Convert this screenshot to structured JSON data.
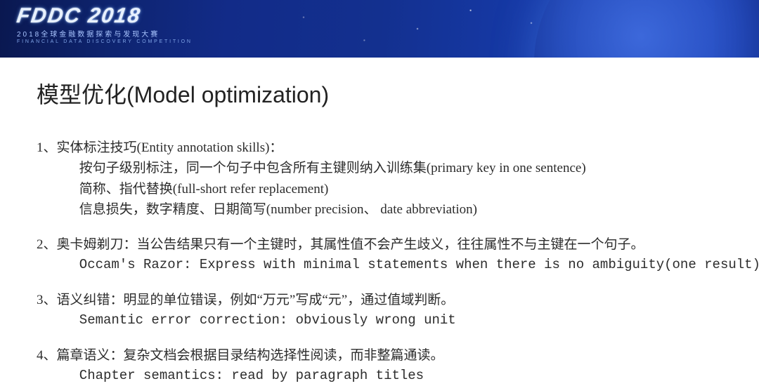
{
  "banner": {
    "logo_main": "FDDC 2018",
    "logo_sub_cn": "2018全球金融数据探索与发现大赛",
    "logo_sub_en": "FINANCIAL DATA DISCOVERY COMPETITION"
  },
  "slide": {
    "title": "模型优化(Model optimization)",
    "items": [
      {
        "head": "1、实体标注技巧(Entity annotation skills)：",
        "lines": [
          "按句子级别标注，同一个句子中包含所有主键则纳入训练集(primary key in one sentence)",
          "简称、指代替换(full-short refer replacement)",
          "信息损失，数字精度、日期简写(number precision、 date abbreviation)"
        ]
      },
      {
        "head": "2、奥卡姆剃刀：当公告结果只有一个主键时，其属性值不会产生歧义，往往属性不与主键在一个句子。",
        "lines": [
          "Occam's Razor: Express with minimal statements when there is no ambiguity(one result)"
        ]
      },
      {
        "head": "3、语义纠错：明显的单位错误，例如“万元”写成“元”，通过值域判断。",
        "lines": [
          "Semantic error correction: obviously wrong unit"
        ]
      },
      {
        "head": "4、篇章语义：复杂文档会根据目录结构选择性阅读，而非整篇通读。",
        "lines": [
          "Chapter semantics: read by paragraph titles"
        ]
      }
    ]
  }
}
